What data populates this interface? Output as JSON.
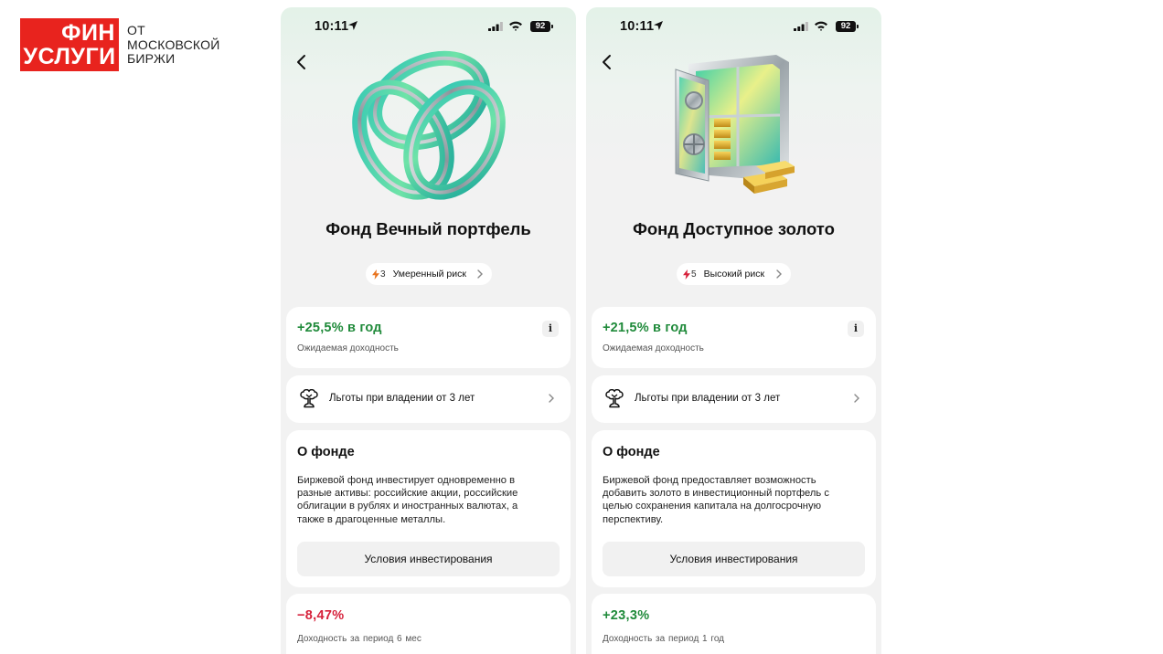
{
  "brand": {
    "logo_line1": "ФИН",
    "logo_line2": "УСЛУГИ",
    "subtitle": [
      "ОТ",
      "МОСКОВСКОЙ",
      "БИРЖИ"
    ],
    "red": "#e8231e"
  },
  "phones": [
    {
      "status": {
        "time": "10:11",
        "battery": "92"
      },
      "hero_icon": "torus-knot-icon",
      "title": "Фонд Вечный портфель",
      "risk": {
        "level": "3",
        "label": "Умеренный риск",
        "color": "#e8731e"
      },
      "yield": {
        "value": "+25,5% в год",
        "caption": "Ожидаемая доходность",
        "info": "i"
      },
      "benefit": {
        "label": "Льготы при владении от 3 лет"
      },
      "about": {
        "heading": "О фонде",
        "lines": [
          "Биржевой фонд инвестирует одновременно в",
          "разные активы: российские акции, российские",
          "облигации в рублях и иностранных валютах, а",
          "также в драгоценные металлы."
        ],
        "button": "Условия инвестирования"
      },
      "performance": {
        "value": "−8,47%",
        "caption": "Доходность за период 6  мес",
        "color": "#d6203a"
      }
    },
    {
      "status": {
        "time": "10:11",
        "battery": "92"
      },
      "hero_icon": "safe-with-gold-icon",
      "title": "Фонд Доступное золото",
      "risk": {
        "level": "5",
        "label": "Высокий риск",
        "color": "#d6203a"
      },
      "yield": {
        "value": "+21,5% в год",
        "caption": "Ожидаемая доходность",
        "info": "i"
      },
      "benefit": {
        "label": "Льготы при владении от 3 лет"
      },
      "about": {
        "heading": "О фонде",
        "lines": [
          "Биржевой фонд предоставляет возможность",
          "добавить золото в инвестиционный портфель с",
          "целью сохранения капитала на долгосрочную",
          "перспективу."
        ],
        "button": "Условия инвестирования"
      },
      "performance": {
        "value": "+23,3%",
        "caption": "Доходность за период 1  год",
        "color": "#1f8a3a"
      }
    }
  ]
}
